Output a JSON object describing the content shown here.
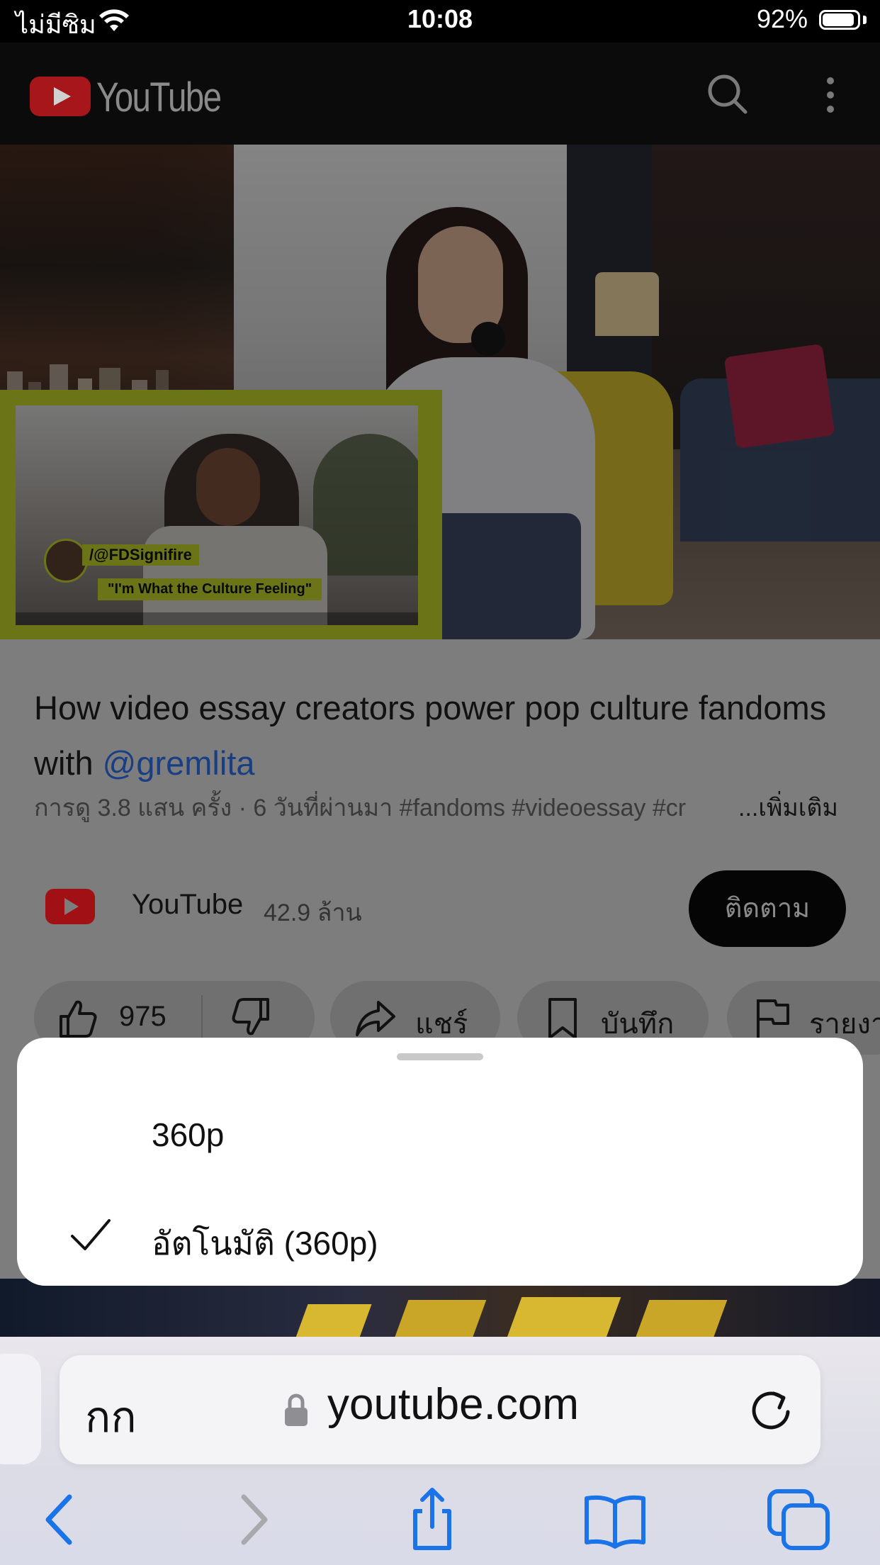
{
  "status_bar": {
    "carrier": "ไม่มีซิม",
    "time": "10:08",
    "battery_percent": "92%",
    "battery_level": 0.92
  },
  "youtube_header": {
    "logo_text": "YouTube"
  },
  "video": {
    "overlay_handle": "/@FDSignifire",
    "overlay_quote": "\"I'm What the Culture Feeling\""
  },
  "details": {
    "title_part1": "How video essay creators power pop culture fandoms with ",
    "title_mention": "@gremlita",
    "meta": "การดู 3.8 แสน ครั้ง · 6 วันที่ผ่านมา  #fandoms #videoessay #cr",
    "more_link": "...เพิ่มเติม",
    "channel_name": "YouTube",
    "channel_subs": "42.9 ล้าน",
    "subscribe_label": "ติดตาม",
    "like_count": "975",
    "share_label": "แชร์",
    "save_label": "บันทึก",
    "report_label": "รายงาน"
  },
  "quality_sheet": {
    "options": [
      {
        "label": "360p",
        "selected": false
      },
      {
        "label": "อัตโนมัติ (360p)",
        "selected": true
      }
    ]
  },
  "browser": {
    "aa_label": "กก",
    "url": "youtube.com"
  },
  "colors": {
    "accent": "#1a73e8",
    "yt_red": "#a6161b"
  }
}
